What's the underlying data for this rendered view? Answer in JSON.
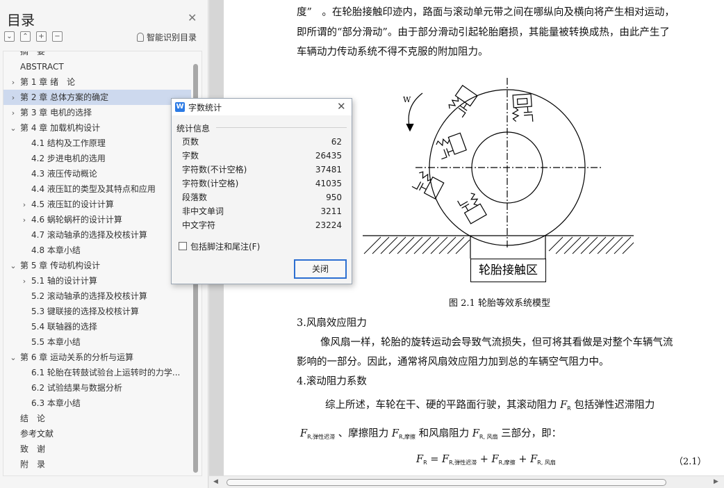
{
  "toc": {
    "title": "目录",
    "smart_identify_label": "智能识别目录",
    "items": [
      {
        "label": "摘　要",
        "level": 0,
        "twisty": "",
        "cut": true
      },
      {
        "label": "ABSTRACT",
        "level": 0,
        "twisty": ""
      },
      {
        "label": "第 1 章  绪　论",
        "level": 0,
        "twisty": "›"
      },
      {
        "label": "第 2 章  总体方案的确定",
        "level": 0,
        "twisty": "›",
        "selected": true
      },
      {
        "label": "第 3 章  电机的选择",
        "level": 0,
        "twisty": "›"
      },
      {
        "label": "第 4 章  加载机构设计",
        "level": 0,
        "twisty": "⌄"
      },
      {
        "label": "4.1 结构及工作原理",
        "level": 1,
        "twisty": ""
      },
      {
        "label": "4.2 步进电机的选用",
        "level": 1,
        "twisty": ""
      },
      {
        "label": "4.3 液压传动概论",
        "level": 1,
        "twisty": ""
      },
      {
        "label": "4.4 液压缸的类型及其特点和应用",
        "level": 1,
        "twisty": ""
      },
      {
        "label": "4.5 液压缸的设计计算",
        "level": 1,
        "twisty": "›"
      },
      {
        "label": "4.6 蜗轮蜗杆的设计计算",
        "level": 1,
        "twisty": "›"
      },
      {
        "label": "4.7 滚动轴承的选择及校核计算",
        "level": 1,
        "twisty": ""
      },
      {
        "label": "4.8 本章小结",
        "level": 1,
        "twisty": ""
      },
      {
        "label": "第 5 章  传动机构设计",
        "level": 0,
        "twisty": "⌄"
      },
      {
        "label": "5.1 轴的设计计算",
        "level": 1,
        "twisty": "›"
      },
      {
        "label": "5.2 滚动轴承的选择及校核计算",
        "level": 1,
        "twisty": ""
      },
      {
        "label": "5.3 键联接的选择及校核计算",
        "level": 1,
        "twisty": ""
      },
      {
        "label": "5.4 联轴器的选择",
        "level": 1,
        "twisty": ""
      },
      {
        "label": "5.5 本章小结",
        "level": 1,
        "twisty": ""
      },
      {
        "label": "第 6 章  运动关系的分析与运算",
        "level": 0,
        "twisty": "⌄"
      },
      {
        "label": "6.1 轮胎在转鼓试验台上运转时的力学...",
        "level": 1,
        "twisty": ""
      },
      {
        "label": "6.2 试验结果与数据分析",
        "level": 1,
        "twisty": ""
      },
      {
        "label": "6.3 本章小结",
        "level": 1,
        "twisty": ""
      },
      {
        "label": "结　论",
        "level": 0,
        "twisty": ""
      },
      {
        "label": "参考文献",
        "level": 0,
        "twisty": ""
      },
      {
        "label": "致　谢",
        "level": 0,
        "twisty": ""
      },
      {
        "label": "附　录",
        "level": 0,
        "twisty": ""
      }
    ]
  },
  "document": {
    "lines": [
      "度”　。在轮胎接触印迹内，路面与滚动单元带之间在哪纵向及横向将产生相对运动，",
      "即所谓的“部分滑动”。由于部分滑动引起轮胎磨损，其能量被转换成热，由此产生了",
      "车辆动力传动系统不得不克服的附加阻力。"
    ],
    "figure_w_label": "W",
    "contact_zone_label": "轮胎接触区",
    "figure_caption": "图 2.1  轮胎等效系统模型",
    "heading_3": "3.风扇效应阻力",
    "para_3": [
      "像风扇一样，轮胎的旋转运动会导致气流损失，但可将其看做是对整个车辆气流",
      "影响的一部分。因此，通常将风扇效应阻力加到总的车辆空气阻力中。"
    ],
    "heading_4": "4.滚动阻力系数",
    "para_4a": "综上所述，车轮在干、硬的平路面行驶，其滚动阻力",
    "para_4a_tail": "包括弹性迟滞阻力",
    "para_4b_mid1": "、摩擦阻力",
    "para_4b_mid2": "和风扇阻力",
    "para_4b_tail": "三部分，即：",
    "symbol_F": "F",
    "sub_R": "R",
    "sub_hyst": "R,弹性迟滞",
    "sub_fric": "R,摩擦",
    "sub_fan": "R, 风扇",
    "equals": "=",
    "plus": "+",
    "equation_number": "（2.1）"
  },
  "dialog": {
    "title": "字数统计",
    "section_label": "统计信息",
    "stats": [
      {
        "label": "页数",
        "value": "62"
      },
      {
        "label": "字数",
        "value": "26435"
      },
      {
        "label": "字符数(不计空格)",
        "value": "37481"
      },
      {
        "label": "字符数(计空格)",
        "value": "41035"
      },
      {
        "label": "段落数",
        "value": "950"
      },
      {
        "label": "非中文单词",
        "value": "3211"
      },
      {
        "label": "中文字符",
        "value": "23224"
      }
    ],
    "checkbox_label": "包括脚注和尾注(F)",
    "checkbox_checked": false,
    "close_button_label": "关闭"
  }
}
